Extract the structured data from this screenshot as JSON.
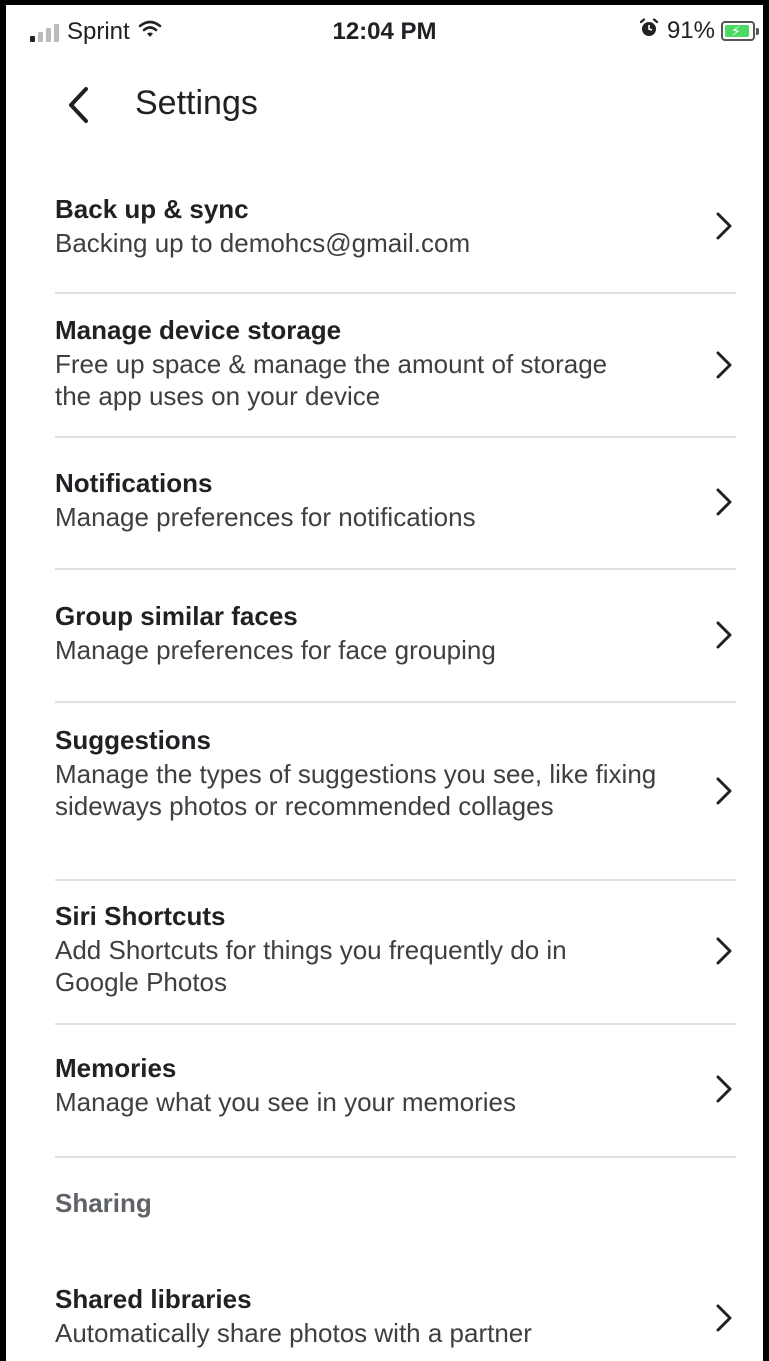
{
  "status_bar": {
    "carrier": "Sprint",
    "time": "12:04 PM",
    "battery_percent": "91%",
    "battery_level": 0.91,
    "icons": [
      "signal-icon",
      "wifi-icon",
      "alarm-icon",
      "battery-charging-icon"
    ]
  },
  "header": {
    "title": "Settings",
    "back_icon": "chevron-left-icon"
  },
  "items": [
    {
      "title": "Back up & sync",
      "subtitle": "Backing up to demohcs@gmail.com"
    },
    {
      "title": "Manage device storage",
      "subtitle": "Free up space & manage the amount of storage the app uses on your device"
    },
    {
      "title": "Notifications",
      "subtitle": "Manage preferences for notifications"
    },
    {
      "title": "Group similar faces",
      "subtitle": "Manage preferences for face grouping"
    },
    {
      "title": "Suggestions",
      "subtitle": "Manage the types of suggestions you see, like fixing sideways photos or recommended collages"
    },
    {
      "title": "Siri Shortcuts",
      "subtitle": "Add Shortcuts for things you frequently do in Google Photos"
    },
    {
      "title": "Memories",
      "subtitle": "Manage what you see in your memories"
    }
  ],
  "sections": {
    "sharing_label": "Sharing"
  },
  "sharing_items": [
    {
      "title": "Shared libraries",
      "subtitle": "Automatically share photos with a partner"
    }
  ],
  "colors": {
    "text_primary": "#202124",
    "text_secondary": "#3c4043",
    "section_label": "#5f6368",
    "divider": "#e0e0e0",
    "battery_green": "#4cd964"
  }
}
